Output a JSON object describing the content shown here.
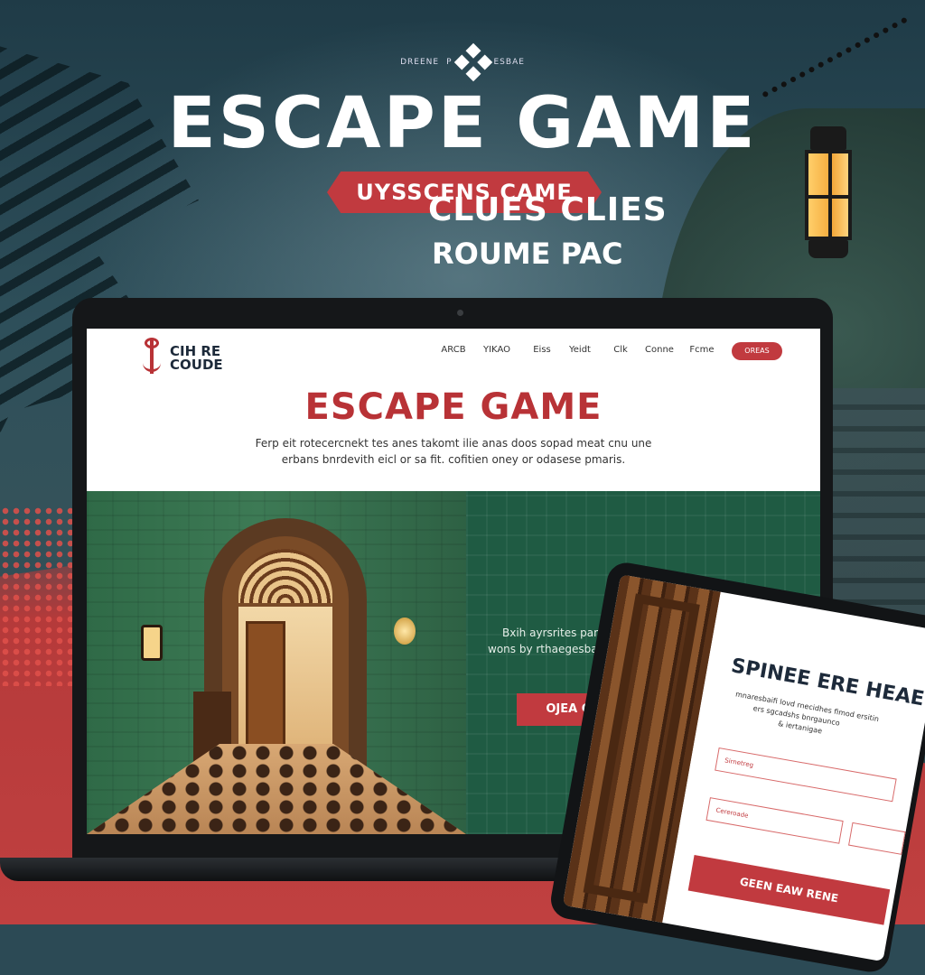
{
  "poster": {
    "brand_left": "DREENE",
    "brand_mid": "P",
    "brand_right": "ESBAE",
    "title": "ESCAPE GAME",
    "ribbon": "UYSSCENS CAME"
  },
  "site": {
    "logo_text": "CIH RE\nCOUDE",
    "logo_line1": "CIH RE",
    "logo_line2": "COUDE",
    "nav": [
      "ARCB",
      "YIKAO",
      "Eiss",
      "Yeidt",
      "Clk",
      "Conne",
      "Fcme"
    ],
    "nav_button": "OREAS",
    "hero_title": "ESCAPE GAME",
    "hero_text_1": "Ferp eit rotecercnekt tes anes takomt ilie anas doos sopad meat cnu une",
    "hero_text_2": "erbans bnrdevith eicl or sa fit. cofitien oney or odasese pmaris.",
    "panel": {
      "heading_1": "CLUES CLIES",
      "heading_2": "ROUME PAC",
      "text_1": "Bxih ayrsrites pardah coradecs",
      "text_2": "wons by rthaegesbats stia na tosc",
      "button": "OJEA CARW"
    }
  },
  "tablet": {
    "title": "SPINEE ERE HEAE",
    "sub_1": "mnaresbaifi lovd rnecidhes fimod ersitin",
    "sub_2": "ers sgcadshs bnrgaunco",
    "sub_3": "& iertanigae",
    "input_1_placeholder": "Sirnetreg",
    "input_2_placeholder": "Cereroade",
    "button": "GEEN EAW RENE"
  },
  "colors": {
    "accent_red": "#c13a3f",
    "forest_green": "#1f5b43",
    "navy_text": "#1d2a3a"
  }
}
